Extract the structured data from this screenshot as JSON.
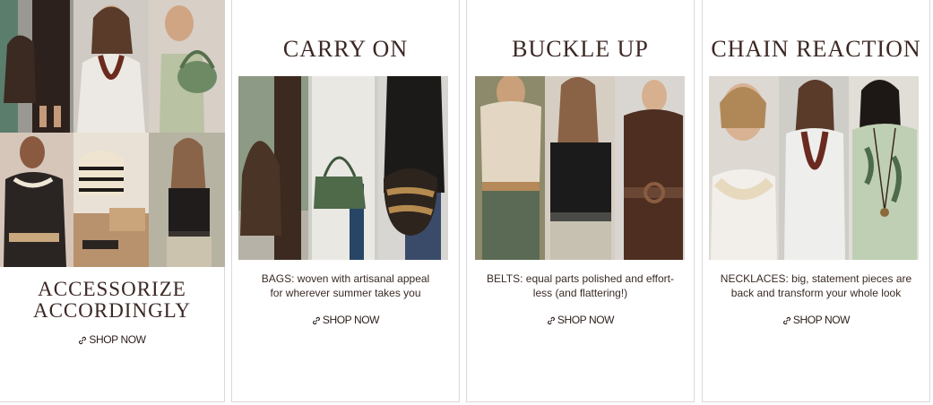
{
  "hero": {
    "title_line1": "ACCESSORIZE",
    "title_line2": "ACCORDINGLY",
    "shop_label": "SHOP NOW"
  },
  "cards": [
    {
      "title": "CARRY ON",
      "desc_line1": "BAGS: woven with artisanal appeal",
      "desc_line2": "for wherever summer takes you",
      "shop_label": "SHOP NOW"
    },
    {
      "title": "BUCKLE UP",
      "desc_line1": "BELTS: equal parts polished and effort-",
      "desc_line2": "less (and flattering!)",
      "shop_label": "SHOP NOW"
    },
    {
      "title": "CHAIN REACTION",
      "desc_line1": "NECKLACES: big, statement pieces are",
      "desc_line2": "back and transform your whole look",
      "shop_label": "SHOP NOW"
    }
  ],
  "colors": {
    "text": "#3a2a24",
    "title": "#3b2723",
    "border": "#d9d9d9"
  },
  "icons": {
    "shop_link": "link-icon"
  }
}
